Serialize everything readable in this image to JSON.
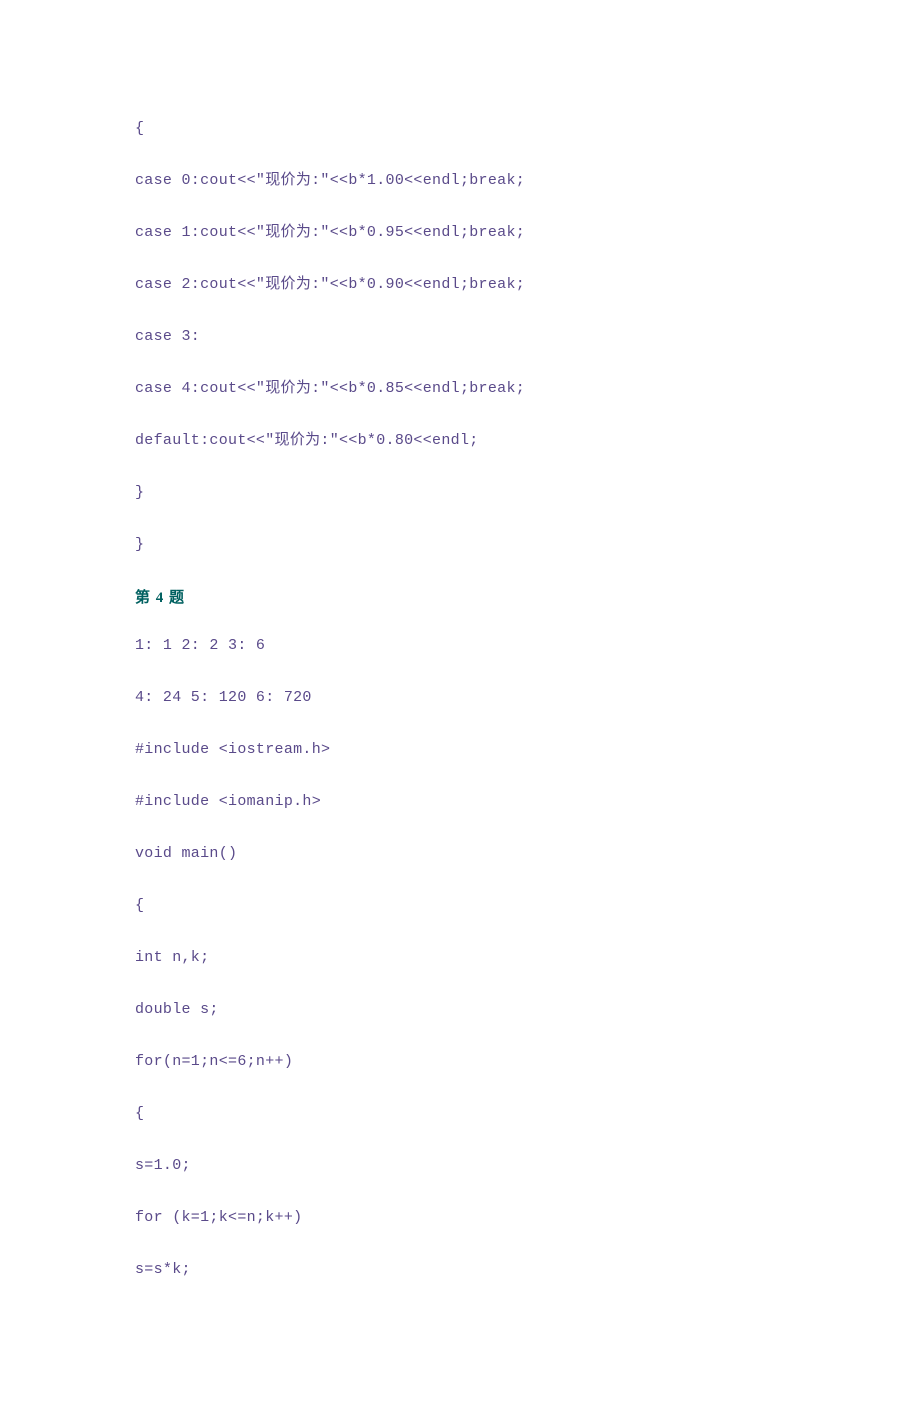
{
  "lines": [
    {
      "type": "code",
      "text": "{"
    },
    {
      "type": "code",
      "text": "case 0:cout<<\"现价为:\"<<b*1.00<<endl;break;"
    },
    {
      "type": "code",
      "text": "case 1:cout<<\"现价为:\"<<b*0.95<<endl;break;"
    },
    {
      "type": "code",
      "text": "case 2:cout<<\"现价为:\"<<b*0.90<<endl;break;"
    },
    {
      "type": "code",
      "text": "case 3:"
    },
    {
      "type": "code",
      "text": "case 4:cout<<\"现价为:\"<<b*0.85<<endl;break;"
    },
    {
      "type": "code",
      "text": "default:cout<<\"现价为:\"<<b*0.80<<endl;"
    },
    {
      "type": "code",
      "text": "}"
    },
    {
      "type": "code",
      "text": "}"
    },
    {
      "type": "heading",
      "text": "第 4 题"
    },
    {
      "type": "code",
      "text": "1: 1 2: 2 3: 6"
    },
    {
      "type": "code",
      "text": "4: 24 5: 120 6: 720"
    },
    {
      "type": "code",
      "text": "#include <iostream.h>"
    },
    {
      "type": "code",
      "text": "#include <iomanip.h>"
    },
    {
      "type": "code",
      "text": "void main()"
    },
    {
      "type": "code",
      "text": "{"
    },
    {
      "type": "code",
      "text": "int n,k;"
    },
    {
      "type": "code",
      "text": "double s;"
    },
    {
      "type": "code",
      "text": "for(n=1;n<=6;n++)"
    },
    {
      "type": "code",
      "text": "{"
    },
    {
      "type": "code",
      "text": "s=1.0;"
    },
    {
      "type": "code",
      "text": "for (k=1;k<=n;k++)"
    },
    {
      "type": "code",
      "text": "s=s*k;"
    }
  ]
}
